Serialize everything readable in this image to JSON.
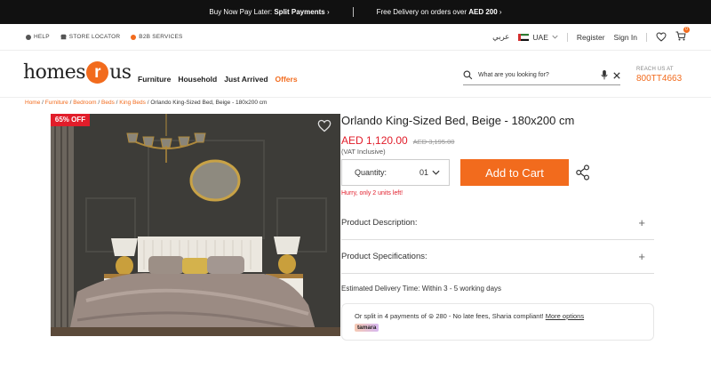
{
  "announcement": {
    "left_prefix": "Buy Now Pay Later:",
    "left_bold": "Split Payments",
    "left_suffix": "›",
    "right_prefix": "Free Delivery on orders over",
    "right_bold": "AED 200",
    "right_suffix": "›"
  },
  "utility": {
    "help": "HELP",
    "store_locator": "STORE LOCATOR",
    "b2b": "B2B SERVICES",
    "language": "عربي",
    "country": "UAE",
    "register": "Register",
    "signin": "Sign In",
    "cart_count": "0",
    "colors": {
      "help_dot": "#555555",
      "b2b_dot": "#f26b1d"
    }
  },
  "header": {
    "logo_left": "homes",
    "logo_mid": "r",
    "logo_right": "us",
    "nav": [
      "Furniture",
      "Household",
      "Just Arrived",
      "Offers"
    ],
    "search_placeholder": "What are you looking for?",
    "reach_label": "REACH US AT",
    "reach_number": "800TT4663"
  },
  "breadcrumb": {
    "items": [
      "Home",
      "Furniture",
      "Bedroom",
      "Beds",
      "King Beds"
    ],
    "current": "Orlando King-Sized Bed, Beige - 180x200 cm"
  },
  "product": {
    "discount_badge": "65% OFF",
    "title": "Orlando King-Sized Bed, Beige - 180x200 cm",
    "price": "AED 1,120.00",
    "old_price": "AED 3,195.00",
    "vat": "(VAT Inclusive)",
    "quantity_label": "Quantity:",
    "quantity_value": "01",
    "add_to_cart": "Add to Cart",
    "hurry": "Hurry, only 2 units left!",
    "accordion": [
      "Product Description:",
      "Product Specifications:"
    ],
    "delivery": "Estimated Delivery Time: Within 3 - 5 working days",
    "tamara_text": "Or split in 4 payments of ⊜ 280 - No late fees, Sharia compliant!",
    "tamara_link": "More options",
    "tamara_logo": "tamara"
  },
  "colors": {
    "accent": "#f26b1d",
    "sale": "#e11d2a",
    "topbar": "#111111"
  }
}
